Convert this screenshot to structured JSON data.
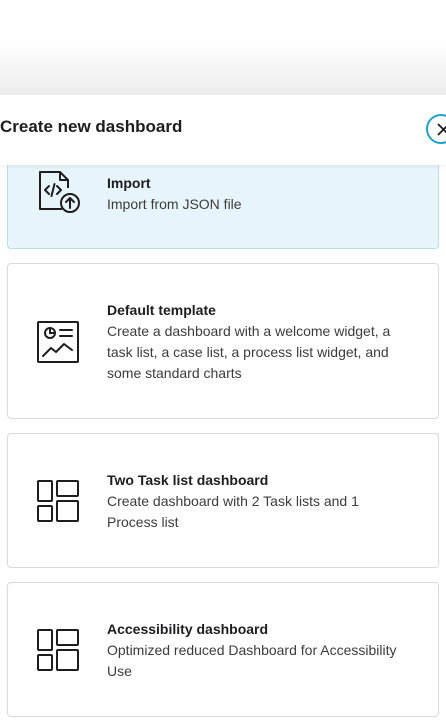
{
  "dialog": {
    "title": "Create new dashboard",
    "close_icon": "close-icon"
  },
  "options": [
    {
      "title": "Import",
      "description": "Import from JSON file",
      "icon": "file-code-upload-icon",
      "selected": true
    },
    {
      "title": "Default template",
      "description": "Create a dashboard with a welcome widget, a task list, a case list, a process list widget, and some standard charts",
      "icon": "chart-document-icon",
      "selected": false
    },
    {
      "title": "Two Task list dashboard",
      "description": "Create dashboard with 2 Task lists and 1 Process list",
      "icon": "dashboard-layout-icon",
      "selected": false
    },
    {
      "title": "Accessibility dashboard",
      "description": "Optimized reduced Dashboard for Accessibility Use",
      "icon": "dashboard-layout-icon",
      "selected": false
    }
  ],
  "colors": {
    "accent": "#1fa3c8",
    "selected_background": "#e7f5fa",
    "selected_border": "#b4dfec",
    "card_border": "#d9d9d9",
    "text": "#1d1d1f"
  }
}
